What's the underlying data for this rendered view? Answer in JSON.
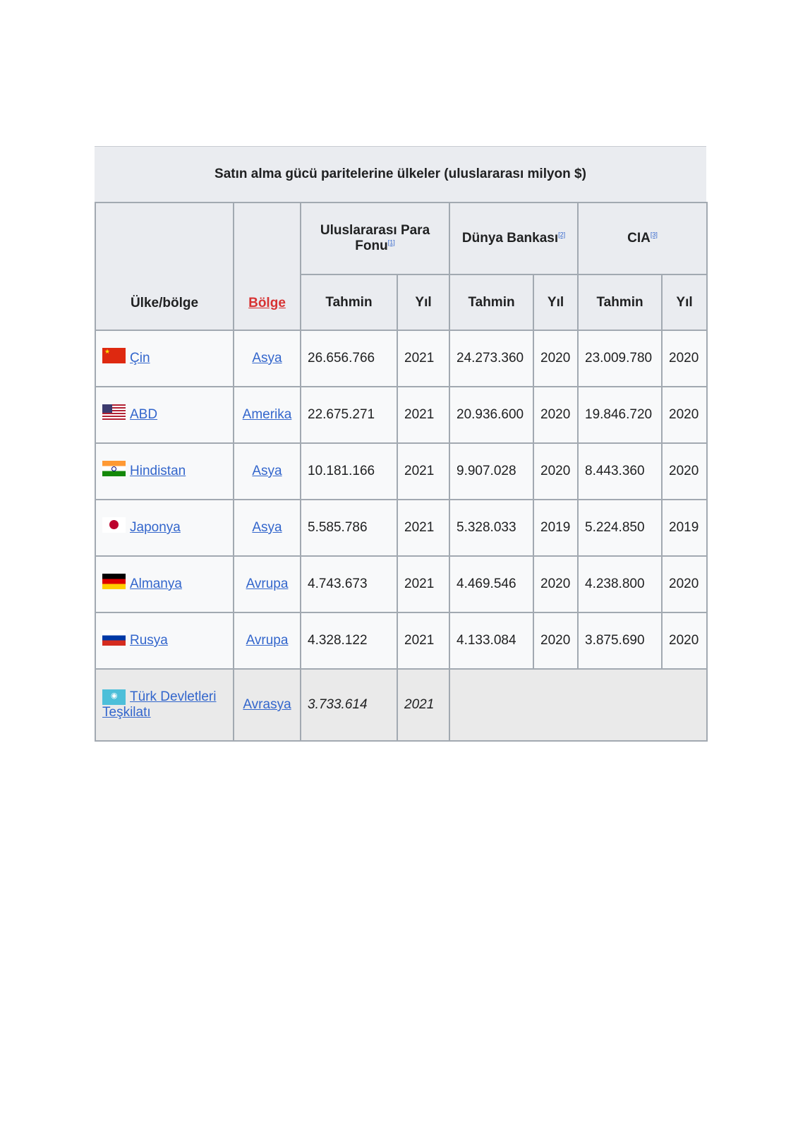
{
  "caption": "Satın alma gücü paritelerine ülkeler (uluslararası milyon $)",
  "headers": {
    "country": "Ülke/bölge",
    "region": "Bölge",
    "imf": "Uluslararası Para Fonu",
    "imf_ref": "[1]",
    "wb": "Dünya Bankası",
    "wb_ref": "[2]",
    "cia": "CIA",
    "cia_ref": "[3]",
    "estimate": "Tahmin",
    "year": "Yıl"
  },
  "rows": [
    {
      "flag": "china-flag-icon",
      "country": "Çin",
      "region": "Asya",
      "imf_est": "26.656.766",
      "imf_year": "2021",
      "wb_est": "24.273.360",
      "wb_year": "2020",
      "cia_est": "23.009.780",
      "cia_year": "2020"
    },
    {
      "flag": "usa-flag-icon",
      "country": "ABD",
      "region": "Amerika",
      "imf_est": "22.675.271",
      "imf_year": "2021",
      "wb_est": "20.936.600",
      "wb_year": "2020",
      "cia_est": "19.846.720",
      "cia_year": "2020"
    },
    {
      "flag": "india-flag-icon",
      "country": "Hindistan",
      "region": "Asya",
      "imf_est": "10.181.166",
      "imf_year": "2021",
      "wb_est": "9.907.028",
      "wb_year": "2020",
      "cia_est": "8.443.360",
      "cia_year": "2020"
    },
    {
      "flag": "japan-flag-icon",
      "country": "Japonya",
      "region": "Asya",
      "imf_est": "5.585.786",
      "imf_year": "2021",
      "wb_est": "5.328.033",
      "wb_year": "2019",
      "cia_est": "5.224.850",
      "cia_year": "2019"
    },
    {
      "flag": "germany-flag-icon",
      "country": "Almanya",
      "region": "Avrupa",
      "imf_est": "4.743.673",
      "imf_year": "2021",
      "wb_est": "4.469.546",
      "wb_year": "2020",
      "cia_est": "4.238.800",
      "cia_year": "2020"
    },
    {
      "flag": "russia-flag-icon",
      "country": "Rusya",
      "region": "Avrupa",
      "imf_est": "4.328.122",
      "imf_year": "2021",
      "wb_est": "4.133.084",
      "wb_year": "2020",
      "cia_est": "3.875.690",
      "cia_year": "2020"
    }
  ],
  "summary_row": {
    "flag": "otd-flag-icon",
    "country": "Türk Devletleri Teşkilatı",
    "region": "Avrasya",
    "imf_est": "3.733.614",
    "imf_year": "2021"
  }
}
